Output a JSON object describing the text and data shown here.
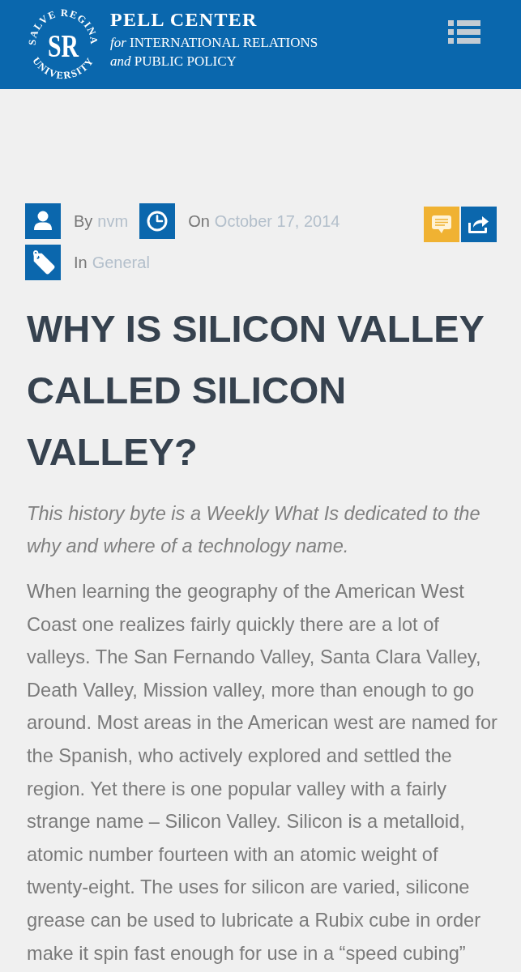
{
  "header": {
    "logo": {
      "ring_top": "SALVE REGINA",
      "ring_bottom": "UNIVERSITY",
      "monogram": "SR"
    },
    "title": "PELL CENTER",
    "subtitle_lines": [
      "*for* INTERNATIONAL RELATIONS",
      "*and* PUBLIC POLICY"
    ]
  },
  "meta": [
    {
      "kind": "author",
      "label": "By",
      "value": "nvm"
    },
    {
      "kind": "date",
      "label": "On",
      "value": "October 17, 2014"
    },
    {
      "kind": "category",
      "label": "In",
      "value": "General"
    }
  ],
  "actions": [
    {
      "kind": "comment"
    },
    {
      "kind": "share"
    }
  ],
  "article": {
    "title": "WHY IS SILICON VALLEY CALLED SILICON VALLEY?",
    "intro": "This history byte is a Weekly What Is dedicated to the why and where of a technology name.",
    "body": "When learning the geography of the American West Coast one realizes fairly quickly there are a lot of valleys. The San Fernando Valley, Santa Clara Valley, Death Valley, Mission valley, more than enough to go around. Most areas in the American west are named for the Spanish, who actively explored and settled the region. Yet there is one popular valley with a fairly strange name – Silicon Valley. Silicon is a metalloid, atomic number fourteen with an atomic weight of twenty-eight. The uses for silicon are varied, silicone grease can be used to lubricate a Rubix cube in order make it spin fast enough for use in a “speed cubing”"
  }
}
